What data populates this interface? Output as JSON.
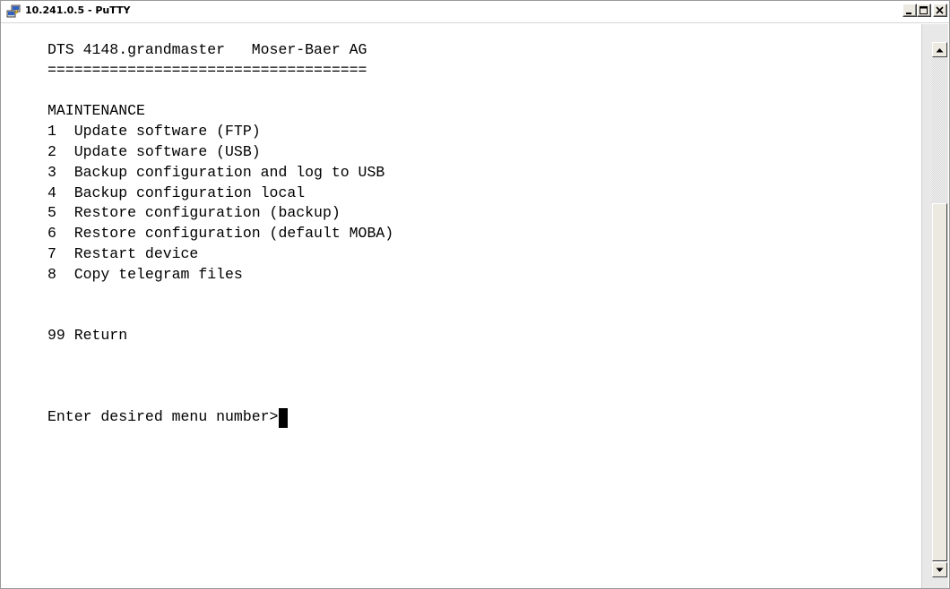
{
  "window": {
    "title": "10.241.0.5 - PuTTY",
    "app_icon": "putty-icon",
    "controls": {
      "minimize_icon": "minimize-icon",
      "maximize_icon": "maximize-icon",
      "close_icon": "close-icon"
    }
  },
  "terminal": {
    "lines": [
      "DTS 4148.grandmaster   Moser-Baer AG",
      "====================================",
      "",
      "MAINTENANCE",
      "1  Update software (FTP)",
      "2  Update software (USB)",
      "3  Backup configuration and log to USB",
      "4  Backup configuration local",
      "5  Restore configuration (backup)",
      "6  Restore configuration (default MOBA)",
      "7  Restart device",
      "8  Copy telegram files",
      "",
      "",
      "99 Return",
      "",
      "",
      "",
      "Enter desired menu number>"
    ]
  },
  "scrollbar": {
    "up_icon": "scroll-up-arrow-icon",
    "down_icon": "scroll-down-arrow-icon"
  },
  "colors": {
    "background": "#ffffff",
    "text": "#000000",
    "chrome": "#ece9e0"
  }
}
